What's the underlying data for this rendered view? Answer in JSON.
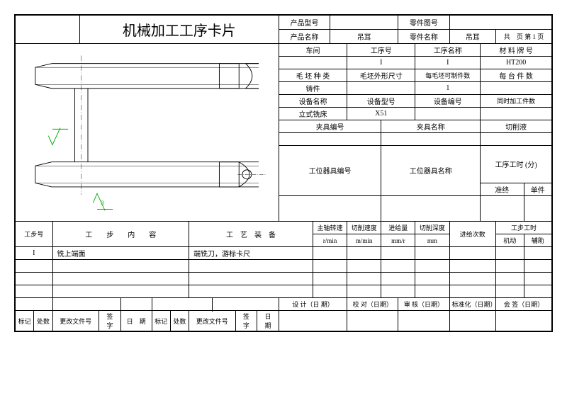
{
  "title": "机械加工工序卡片",
  "header": {
    "productModelLabel": "产品型号",
    "productModel": "",
    "partDrawingNoLabel": "零件图号",
    "partDrawingNo": "",
    "productNameLabel": "产品名称",
    "productName": "吊耳",
    "partNameLabel": "零件名称",
    "partName": "吊耳",
    "total": "共",
    "page": "页",
    "pageNo": "第",
    "pageNum": "1"
  },
  "meta": {
    "workshopLabel": "车间",
    "workshop": "",
    "procNoLabel": "工序号",
    "procNo": "I",
    "procNameLabel": "工序名称",
    "procName": "I",
    "materialLabel": "材 料 牌 号",
    "material": "HT200",
    "blankTypeLabel": "毛 坯 种 类",
    "blankType": "铸件",
    "blankDimLabel": "毛坯外形尺寸",
    "blankDim": "",
    "blankQtyLabel": "每毛坯可制件数",
    "blankQty": "1",
    "perMachineLabel": "每 台 件 数",
    "perMachine": "",
    "equipNameLabel": "设备名称",
    "equipName": "立式铣床",
    "equipModelLabel": "设备型号",
    "equipModel": "X51",
    "equipNoLabel": "设备编号",
    "equipNo": "",
    "simulPartsLabel": "同时加工件数",
    "simulParts": "",
    "fixtureNoLabel": "夹具编号",
    "fixtureNo": "",
    "fixtureNameLabel": "夹具名称",
    "fixtureName": "",
    "coolantLabel": "切削液",
    "coolant": "",
    "toolNoLabel": "工位器具编号",
    "toolNo": "",
    "toolNameLabel": "工位器具名称",
    "toolName": "",
    "procTimeLabel": "工序工时 (分)",
    "prepLabel": "准终",
    "unitLabel": "单件"
  },
  "stepHeader": {
    "stepNo": "工步号",
    "stepContent": "工　　步　　内　　容",
    "processEquip": "工　艺　装　备",
    "spindleSpeed": "主轴转速",
    "spindleSpeedUnit": "r/min",
    "cutSpeed": "切削速度",
    "cutSpeedUnit": "m/min",
    "feed": "进给量",
    "feedUnit": "mm/r",
    "cutDepth": "切削深度",
    "cutDepthUnit": "mm",
    "feedCount": "进给次数",
    "stepTime": "工步工时",
    "machine": "机动",
    "aux": "辅助"
  },
  "steps": [
    {
      "no": "I",
      "content": "铣上端面",
      "equip": "端铣刀，游标卡尺"
    }
  ],
  "footer": {
    "design": "设 计（日 期）",
    "check": "校 对（日期）",
    "audit": "审 核（日期）",
    "standard": "标准化（日期）",
    "sign": "会 签（日期）",
    "mark": "标记",
    "qty": "处数",
    "changeDoc": "更改文件号",
    "sig": "签　字",
    "date": "日　期"
  }
}
